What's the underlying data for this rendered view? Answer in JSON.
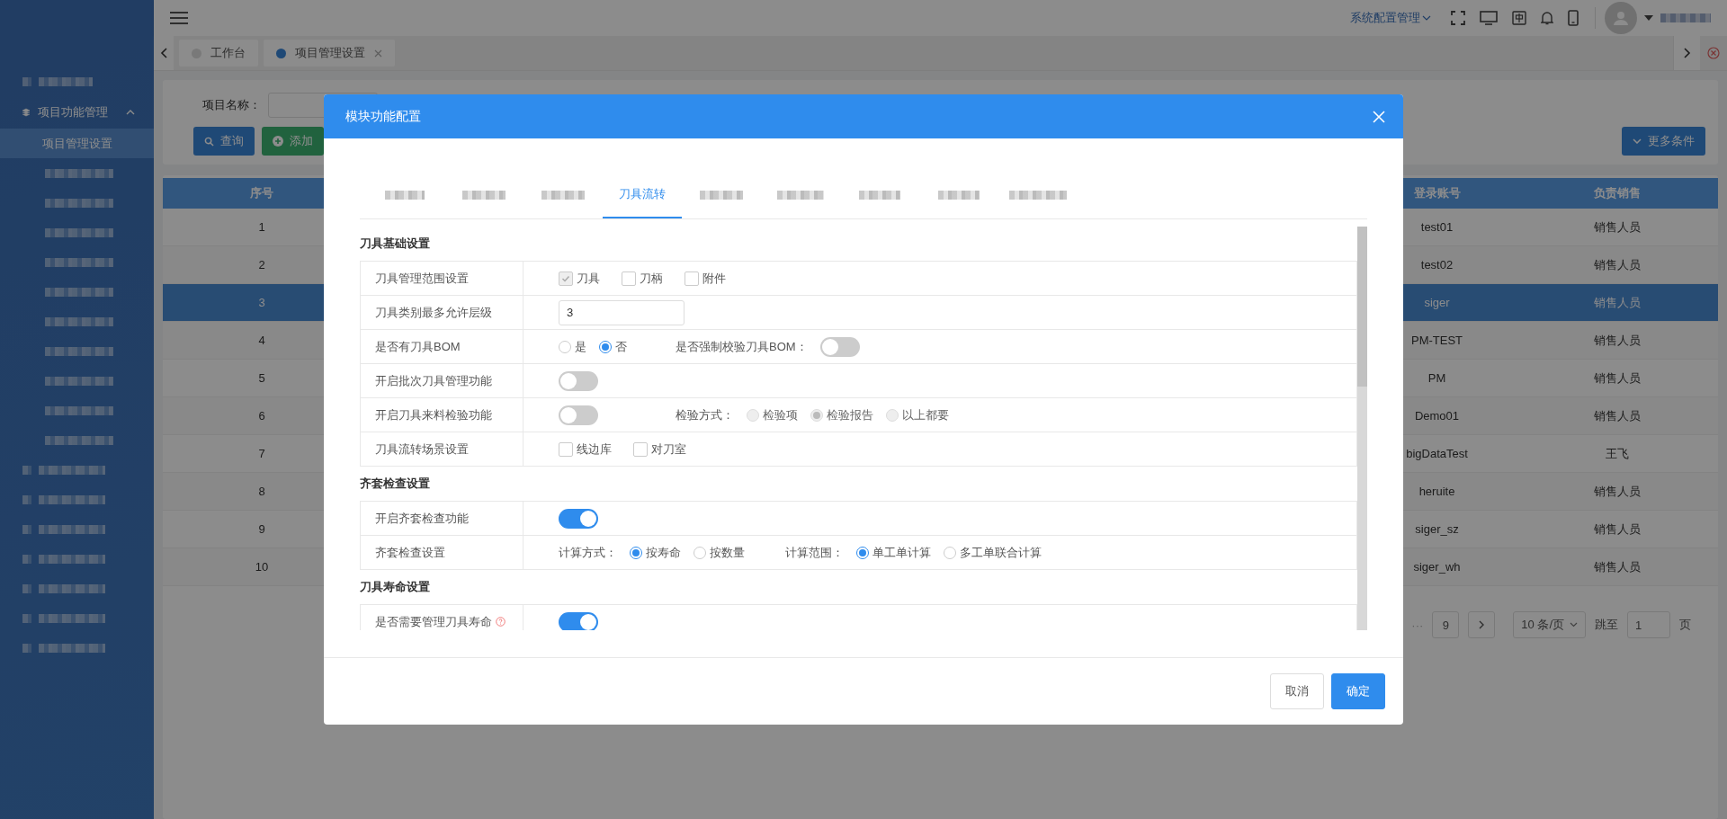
{
  "header": {
    "menu": "系统配置管理"
  },
  "page_tabs": [
    {
      "label": "工作台",
      "selected": false,
      "closable": false
    },
    {
      "label": "项目管理设置",
      "selected": true,
      "closable": true
    }
  ],
  "sidebar": {
    "group": "项目功能管理",
    "expanded": true,
    "items": [
      {
        "label": "项目管理设置",
        "selected": true
      }
    ]
  },
  "search": {
    "label": "项目名称：",
    "buttons": [
      {
        "kind": "search",
        "label": "查询"
      },
      {
        "kind": "add",
        "label": "添加"
      }
    ],
    "more": "更多条件"
  },
  "table": {
    "columns": [
      "序号",
      "登录账号",
      "负责销售"
    ],
    "rows": [
      {
        "cells": [
          "1",
          "test01",
          "销售人员"
        ],
        "selected": false
      },
      {
        "cells": [
          "2",
          "test02",
          "销售人员"
        ],
        "selected": false
      },
      {
        "cells": [
          "3",
          "siger",
          "销售人员"
        ],
        "selected": true
      },
      {
        "cells": [
          "4",
          "PM-TEST",
          "销售人员"
        ],
        "selected": false
      },
      {
        "cells": [
          "5",
          "PM",
          "销售人员"
        ],
        "selected": false
      },
      {
        "cells": [
          "6",
          "Demo01",
          "销售人员"
        ],
        "selected": false
      },
      {
        "cells": [
          "7",
          "bigDataTest",
          "王飞"
        ],
        "selected": false
      },
      {
        "cells": [
          "8",
          "heruite",
          "销售人员"
        ],
        "selected": false
      },
      {
        "cells": [
          "9",
          "siger_sz",
          "销售人员"
        ],
        "selected": false
      },
      {
        "cells": [
          "10",
          "siger_wh",
          "销售人员"
        ],
        "selected": false
      }
    ]
  },
  "pagination": {
    "ellipsis": "···",
    "page": "9",
    "page_size": "10 条/页",
    "jump_label": "跳至",
    "jump_value": "1",
    "page_unit": "页"
  },
  "dialog": {
    "title": "模块功能配置",
    "tabs": [
      {
        "label": "刀具流转",
        "selected": true
      }
    ],
    "sections": [
      {
        "title": "刀具基础设置",
        "rows": [
          {
            "label": "刀具管理范围设置",
            "help": false,
            "groups": [
              [
                {
                  "kind": "checkbox",
                  "label": "刀具",
                  "checked": true,
                  "disabled": true
                },
                {
                  "kind": "checkbox",
                  "label": "刀柄",
                  "checked": false,
                  "disabled": false
                },
                {
                  "kind": "checkbox",
                  "label": "附件",
                  "checked": false,
                  "disabled": false
                }
              ]
            ]
          },
          {
            "label": "刀具类别最多允许层级",
            "help": false,
            "groups": [
              [
                {
                  "kind": "input",
                  "value": "3"
                }
              ]
            ]
          },
          {
            "label": "是否有刀具BOM",
            "help": false,
            "groups": [
              [
                {
                  "kind": "radio",
                  "label": "是",
                  "selected": false,
                  "disabled": false
                },
                {
                  "kind": "radio",
                  "label": "否",
                  "selected": true,
                  "disabled": false
                }
              ],
              [
                {
                  "kind": "text",
                  "text": "是否强制校验刀具BOM："
                },
                {
                  "kind": "switch",
                  "on": false
                }
              ]
            ]
          },
          {
            "label": "开启批次刀具管理功能",
            "help": false,
            "groups": [
              [
                {
                  "kind": "switch",
                  "on": false
                }
              ]
            ]
          },
          {
            "label": "开启刀具来料检验功能",
            "help": false,
            "groups": [
              [
                {
                  "kind": "switch",
                  "on": false
                }
              ],
              [
                {
                  "kind": "text",
                  "text": "检验方式："
                },
                {
                  "kind": "radio",
                  "label": "检验项",
                  "selected": false,
                  "disabled": true
                },
                {
                  "kind": "radio",
                  "label": "检验报告",
                  "selected": true,
                  "disabled": true
                },
                {
                  "kind": "radio",
                  "label": "以上都要",
                  "selected": false,
                  "disabled": true
                }
              ]
            ]
          },
          {
            "label": "刀具流转场景设置",
            "help": false,
            "groups": [
              [
                {
                  "kind": "checkbox",
                  "label": "线边库",
                  "checked": false,
                  "disabled": false
                },
                {
                  "kind": "checkbox",
                  "label": "对刀室",
                  "checked": false,
                  "disabled": false
                }
              ]
            ]
          }
        ]
      },
      {
        "title": "齐套检查设置",
        "rows": [
          {
            "label": "开启齐套检查功能",
            "help": false,
            "groups": [
              [
                {
                  "kind": "switch",
                  "on": true
                }
              ]
            ]
          },
          {
            "label": "齐套检查设置",
            "help": false,
            "groups": [
              [
                {
                  "kind": "text",
                  "text": "计算方式："
                },
                {
                  "kind": "radio",
                  "label": "按寿命",
                  "selected": true,
                  "disabled": false
                },
                {
                  "kind": "radio",
                  "label": "按数量",
                  "selected": false,
                  "disabled": false
                }
              ],
              [
                {
                  "kind": "text",
                  "text": "计算范围："
                },
                {
                  "kind": "radio",
                  "label": "单工单计算",
                  "selected": true,
                  "disabled": false
                },
                {
                  "kind": "radio",
                  "label": "多工单联合计算",
                  "selected": false,
                  "disabled": false
                }
              ]
            ]
          }
        ]
      },
      {
        "title": "刀具寿命设置",
        "rows": [
          {
            "label": "是否需要管理刀具寿命",
            "help": true,
            "groups": [
              [
                {
                  "kind": "switch",
                  "on": true
                }
              ]
            ]
          }
        ]
      }
    ],
    "buttons": [
      {
        "kind": "cancel",
        "label": "取消"
      },
      {
        "kind": "confirm",
        "label": "确定"
      }
    ]
  }
}
